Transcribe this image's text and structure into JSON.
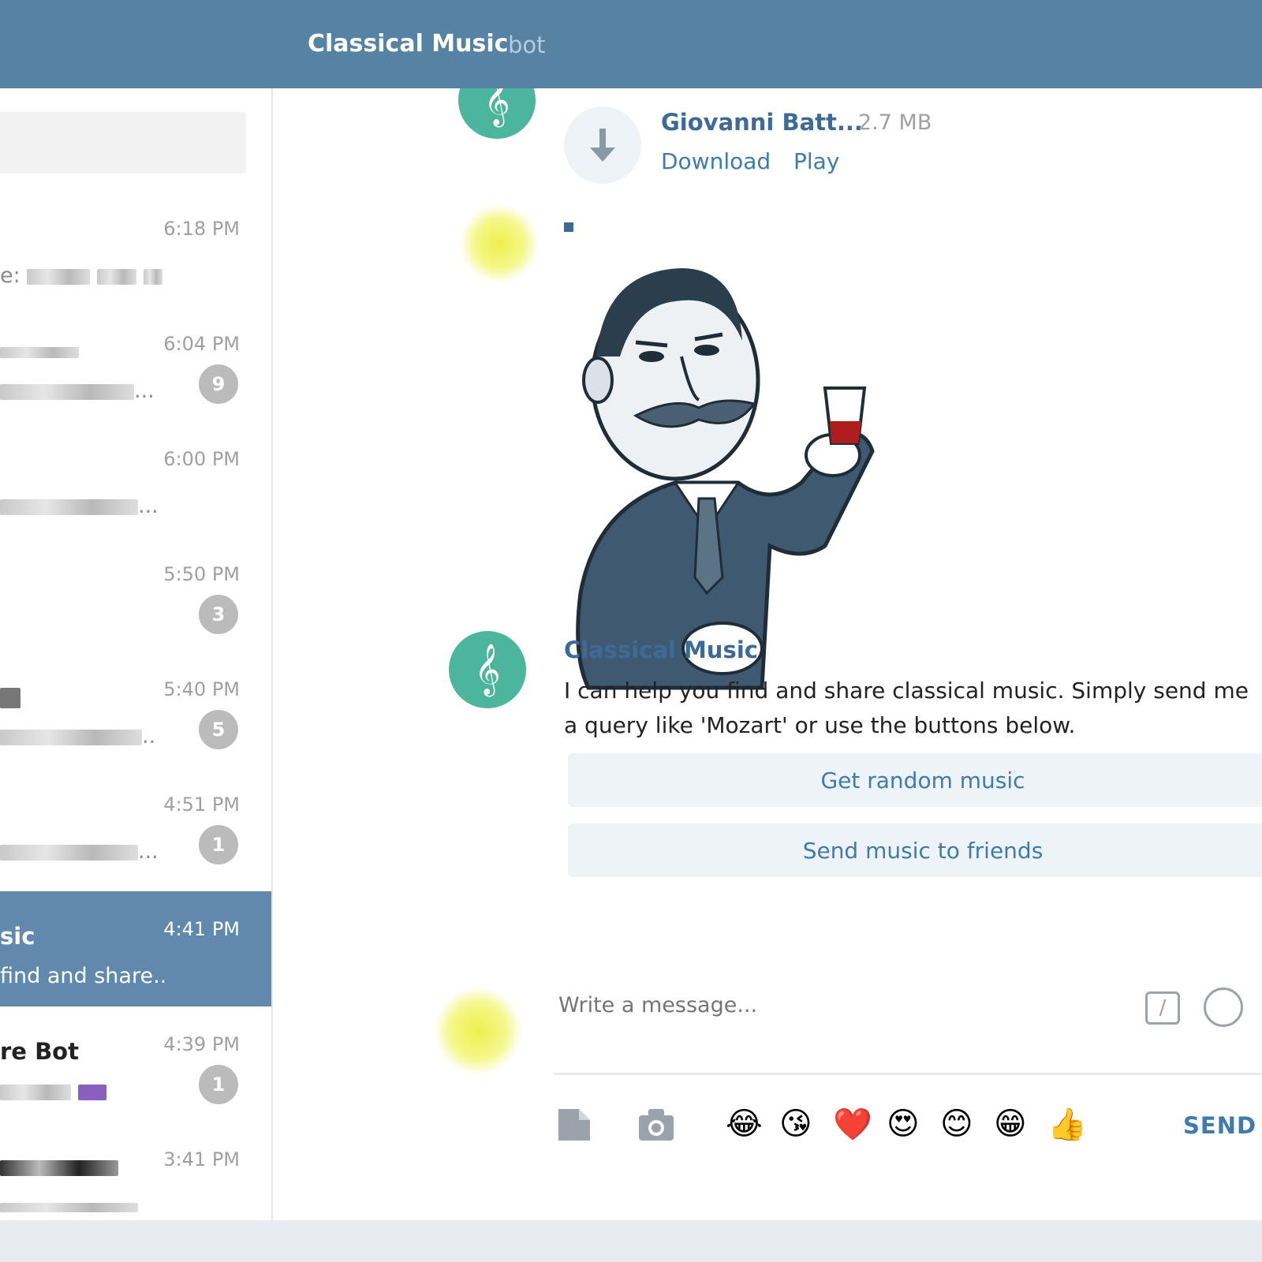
{
  "header": {
    "title": "Classical Music",
    "subtitle": "bot"
  },
  "sidebar": {
    "chats": [
      {
        "time": "6:18 PM",
        "name": "",
        "preview": "e:",
        "badge": ""
      },
      {
        "time": "6:04 PM",
        "name": "",
        "preview": "...",
        "badge": "9"
      },
      {
        "time": "6:00 PM",
        "name": "",
        "preview": "...",
        "badge": ""
      },
      {
        "time": "5:50 PM",
        "name": "",
        "preview": "",
        "badge": "3"
      },
      {
        "time": "5:40 PM",
        "name": "",
        "preview": "..",
        "badge": "5"
      },
      {
        "time": "4:51 PM",
        "name": "",
        "preview": "...",
        "badge": "1"
      },
      {
        "time": "4:41 PM",
        "name": "sic",
        "preview": "find and share..",
        "badge": ""
      },
      {
        "time": "4:39 PM",
        "name": "re Bot",
        "preview": "",
        "badge": "1"
      },
      {
        "time": "3:41 PM",
        "name": "",
        "preview": "",
        "badge": ""
      }
    ]
  },
  "file": {
    "name": "Giovanni Batt...",
    "size": "2.7 MB",
    "download": "Download",
    "play": "Play"
  },
  "message": {
    "sender": "Classical Music",
    "text": "I can help you find and share classical music. Simply send me a query like 'Mozart' or use the buttons below.",
    "buttons": [
      "Get random music",
      "Send music to friends"
    ]
  },
  "composer": {
    "placeholder": "Write a message...",
    "send": "SEND"
  },
  "emojis": [
    "😂",
    "😘",
    "❤️",
    "😍",
    "😊",
    "😁",
    "👍"
  ],
  "icons": [
    "treble-clef-icon",
    "download-arrow-icon",
    "attach-file-icon",
    "camera-icon",
    "bot-command-icon",
    "emoji-icon"
  ]
}
